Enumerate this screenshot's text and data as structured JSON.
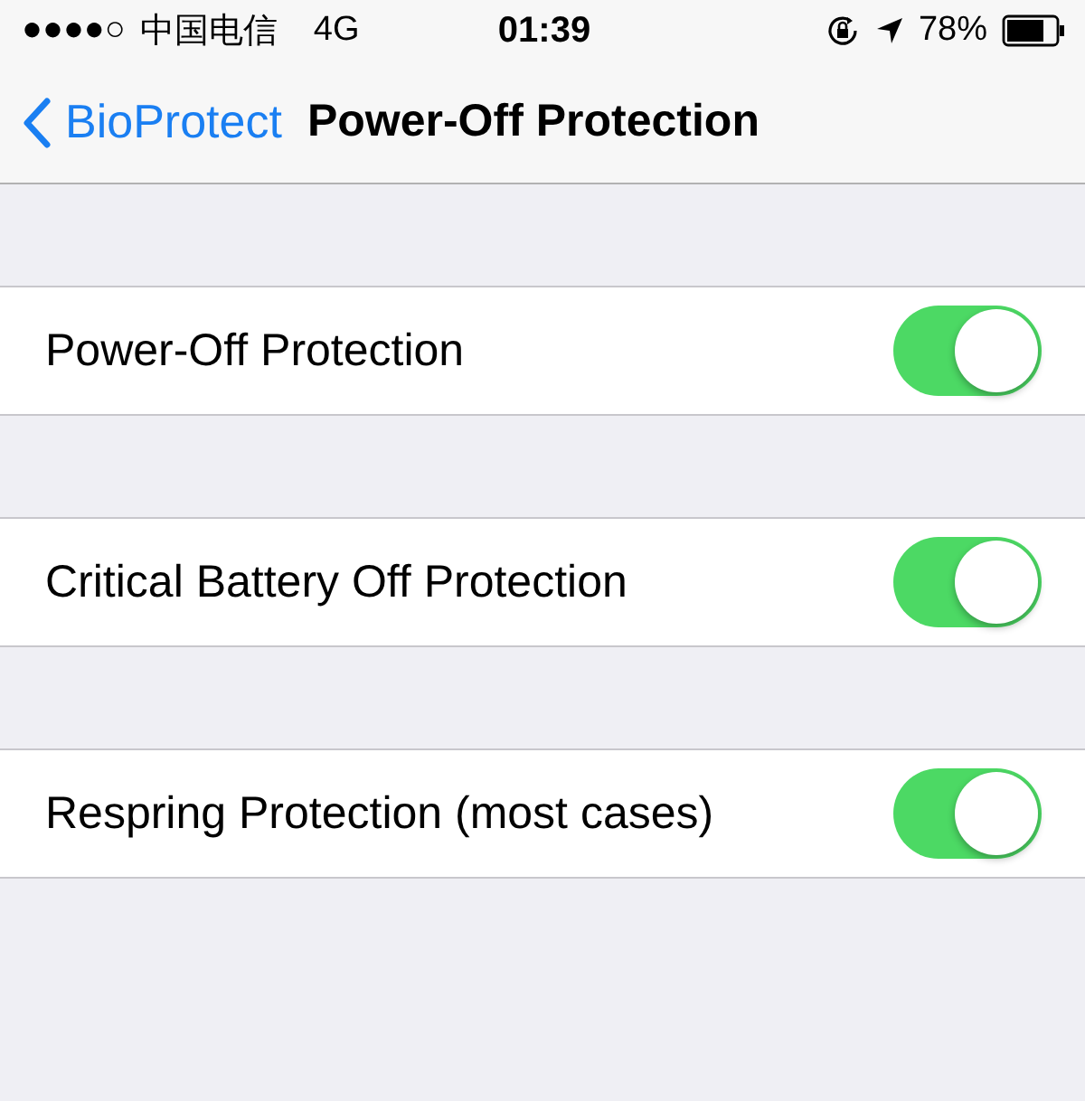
{
  "status_bar": {
    "signal": "●●●●○",
    "carrier": "中国电信",
    "network": "4G",
    "time": "01:39",
    "battery": "78%"
  },
  "nav_bar": {
    "back_label": "BioProtect",
    "title": "Power-Off Protection"
  },
  "settings": [
    {
      "label": "Power-Off Protection",
      "on": true
    },
    {
      "label": "Critical Battery Off Protection",
      "on": true
    },
    {
      "label": "Respring Protection (most cases)",
      "on": true
    }
  ]
}
